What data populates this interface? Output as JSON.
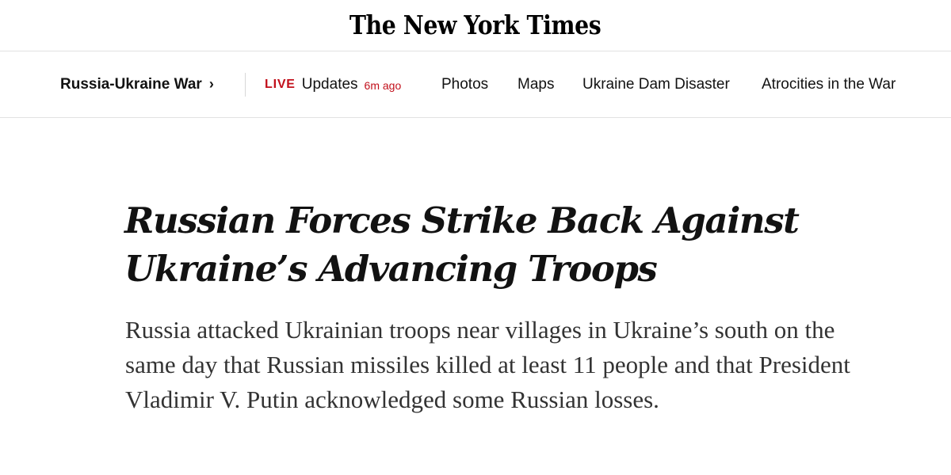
{
  "masthead": {
    "logo_text": "The New York Times"
  },
  "nav": {
    "section_label": "Russia-Ukraine War",
    "section_chevron": "›",
    "live": {
      "tag": "LIVE",
      "label": "Updates",
      "time": "6m ago"
    },
    "links": [
      {
        "label": "Photos"
      },
      {
        "label": "Maps"
      },
      {
        "label": "Ukraine Dam Disaster"
      },
      {
        "label": "Atrocities in the War"
      }
    ]
  },
  "article": {
    "headline_line1": "Russian Forces Strike Back Against",
    "headline_line2": "Ukraine’s Advancing Troops",
    "summary": "Russia attacked Ukrainian troops near villages in Ukraine’s south on the same day that Russian missiles killed at least 11 people and that President Vladimir V. Putin acknowledged some Russian losses."
  },
  "colors": {
    "live_red": "#c2101b",
    "text": "#121212",
    "summary_text": "#333333",
    "divider": "#e2e2e2"
  }
}
